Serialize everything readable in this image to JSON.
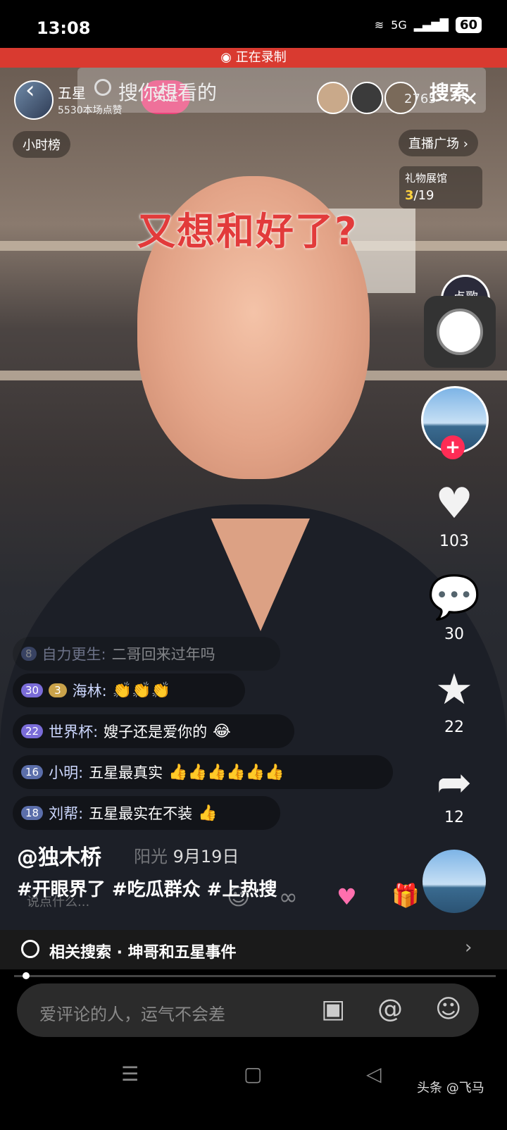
{
  "status_bar": {
    "time": "13:08",
    "network": "5G",
    "battery": "60"
  },
  "recording": {
    "label": "正在录制"
  },
  "header": {
    "anchor_name": "五星",
    "anchor_likes": "5530本场点赞",
    "follow_label": "关注",
    "search_placeholder": "搜你想看的",
    "search_button": "搜索",
    "viewer_count": "2765"
  },
  "live": {
    "hour_rank": "小时榜",
    "live_square": "直播广场",
    "gift_hall_title": "礼物展馆",
    "gift_progress_current": "3",
    "gift_progress_total": "/19",
    "song_badge": "点歌"
  },
  "overlay_title": "又想和好了?",
  "actions": {
    "likes": "103",
    "comments": "30",
    "favorites": "22",
    "shares": "12"
  },
  "comments": [
    {
      "level": "8",
      "user": "自力更生:",
      "text": "二哥回来过年吗",
      "emoji": ""
    },
    {
      "level": "30",
      "fan": "3",
      "user": "海林:",
      "text": "",
      "emoji": "👏👏👏"
    },
    {
      "level": "22",
      "user": "世界杯:",
      "text": "嫂子还是爱你的",
      "emoji": "😂"
    },
    {
      "level": "16",
      "user": "小明:",
      "text": "五星最真实",
      "emoji": "👍👍👍👍👍👍"
    },
    {
      "level": "18",
      "user": "刘帮:",
      "text": "五星最实在不装",
      "emoji": "👍"
    }
  ],
  "caption": {
    "author": "@独木桥",
    "faded_comment": "阳光",
    "date": "9月19日",
    "hashtags": "#开眼界了 #吃瓜群众 #上热搜",
    "say_something": "说点什么..."
  },
  "related_search": {
    "label": "相关搜索 · 坤哥和五星事件"
  },
  "comment_input": {
    "placeholder": "爱评论的人，运气不会差"
  },
  "watermark": "头条 @飞马"
}
